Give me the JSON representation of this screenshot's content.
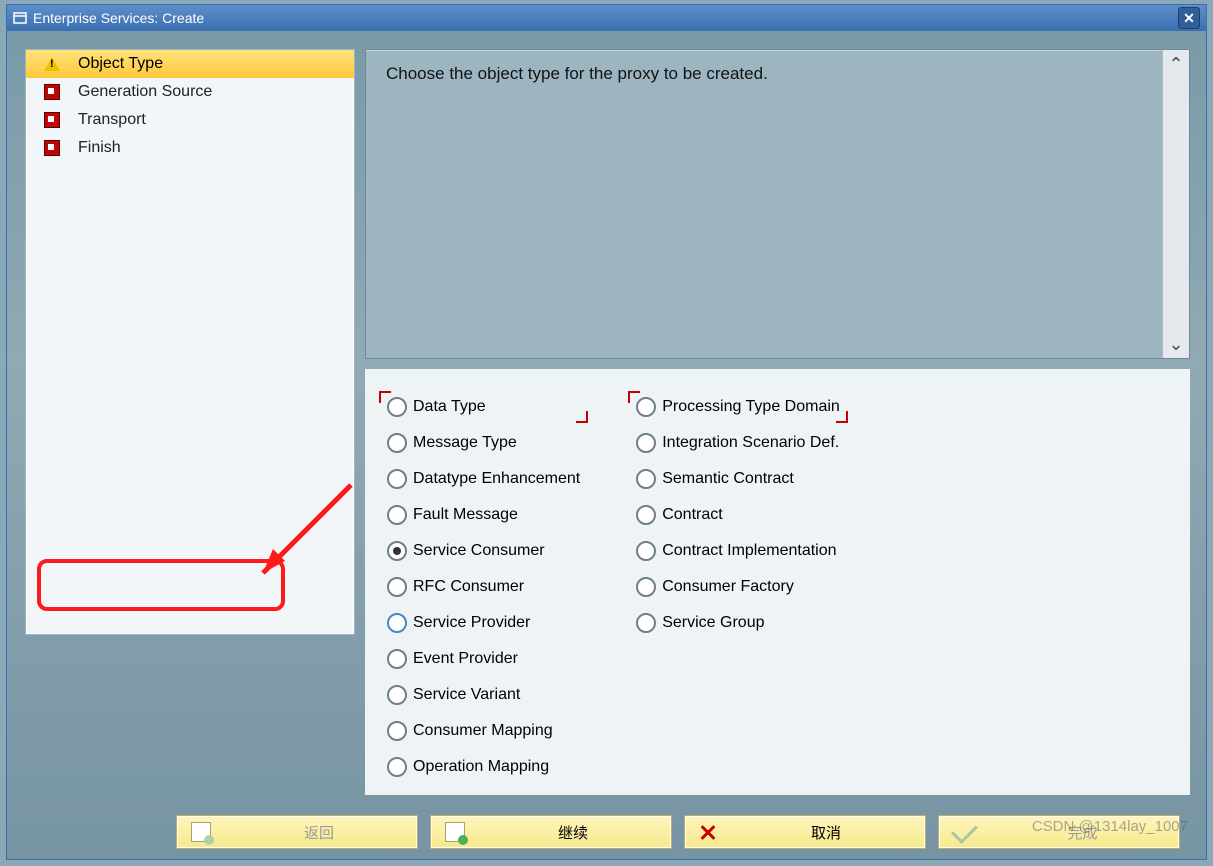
{
  "window": {
    "title": "Enterprise Services: Create"
  },
  "steps": [
    {
      "label": "Object Type",
      "icon": "warn",
      "selected": true
    },
    {
      "label": "Generation Source",
      "icon": "red",
      "selected": false
    },
    {
      "label": "Transport",
      "icon": "red",
      "selected": false
    },
    {
      "label": "Finish",
      "icon": "red",
      "selected": false
    }
  ],
  "instruction": "Choose the object type for the proxy to be created.",
  "options_col1": [
    {
      "label": "Data Type",
      "focus": true
    },
    {
      "label": "Message Type"
    },
    {
      "label": "Datatype Enhancement"
    },
    {
      "label": "Fault Message"
    },
    {
      "label": "Service Consumer",
      "selected": true,
      "highlighted": true
    },
    {
      "label": "RFC Consumer"
    },
    {
      "label": "Service Provider",
      "blue": true
    },
    {
      "label": "Event Provider"
    },
    {
      "label": "Service Variant"
    },
    {
      "label": "Consumer Mapping"
    },
    {
      "label": "Operation Mapping"
    }
  ],
  "options_col2": [
    {
      "label": "Processing Type Domain",
      "focus": true
    },
    {
      "label": "Integration Scenario Def."
    },
    {
      "label": "Semantic Contract"
    },
    {
      "label": "Contract"
    },
    {
      "label": "Contract Implementation"
    },
    {
      "label": "Consumer Factory"
    },
    {
      "label": "Service Group"
    }
  ],
  "buttons": {
    "back": {
      "label": "返回",
      "enabled": false
    },
    "next": {
      "label": "继续",
      "enabled": true
    },
    "cancel": {
      "label": "取消",
      "enabled": true
    },
    "finish": {
      "label": "完成",
      "enabled": false
    }
  },
  "watermark": "CSDN @1314lay_1007"
}
